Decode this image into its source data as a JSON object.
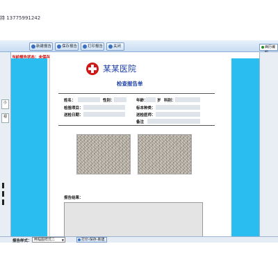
{
  "window": {
    "title_text": "持 13775991242"
  },
  "toolbar": {
    "buttons": [
      {
        "label": "新建报告"
      },
      {
        "label": "保存报告"
      },
      {
        "label": "打印报告"
      },
      {
        "label": "关闭"
      }
    ]
  },
  "status": {
    "label": "当前报告状态：未保存"
  },
  "left_panel": {
    "item1": "小",
    "item2": "视"
  },
  "right_panel": {
    "tab_label": "病历编辑"
  },
  "report": {
    "hospital_name": "某某医院",
    "title": "检查报告单",
    "fields": {
      "name": "姓名：",
      "gender": "性别：",
      "age": "年龄：",
      "age_unit": "岁",
      "department": "科别：",
      "exam_item": "检验项目：",
      "sample_type": "标本种类：",
      "exam_date": "送检日期：",
      "doctor": "送检医师：",
      "remark": "备注"
    },
    "result_label": "报告结果："
  },
  "bottom": {
    "format_label": "报告样式：",
    "format_value": "两幅图样式二",
    "print_save_button": "打印-保存-新建"
  }
}
